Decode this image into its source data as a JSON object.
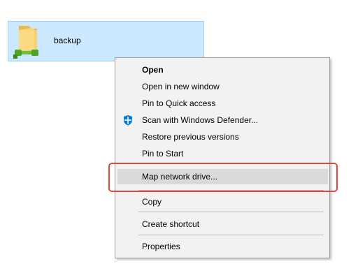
{
  "folder": {
    "name": "backup",
    "icon": "network-folder-icon"
  },
  "context_menu": {
    "items": [
      {
        "label": "Open",
        "bold": true
      },
      {
        "label": "Open in new window"
      },
      {
        "label": "Pin to Quick access"
      },
      {
        "label": "Scan with Windows Defender...",
        "icon": "windows-defender-icon"
      },
      {
        "label": "Restore previous versions"
      },
      {
        "label": "Pin to Start"
      },
      {
        "label": "Map network drive...",
        "highlighted": true
      },
      {
        "label": "Copy"
      },
      {
        "label": "Create shortcut"
      },
      {
        "label": "Properties"
      }
    ]
  },
  "colors": {
    "selection_bg": "#cce8ff",
    "menu_bg": "#f2f2f2",
    "hover_bg": "#dadada",
    "highlight_border": "#e8483a",
    "defender_blue": "#0078d7"
  }
}
